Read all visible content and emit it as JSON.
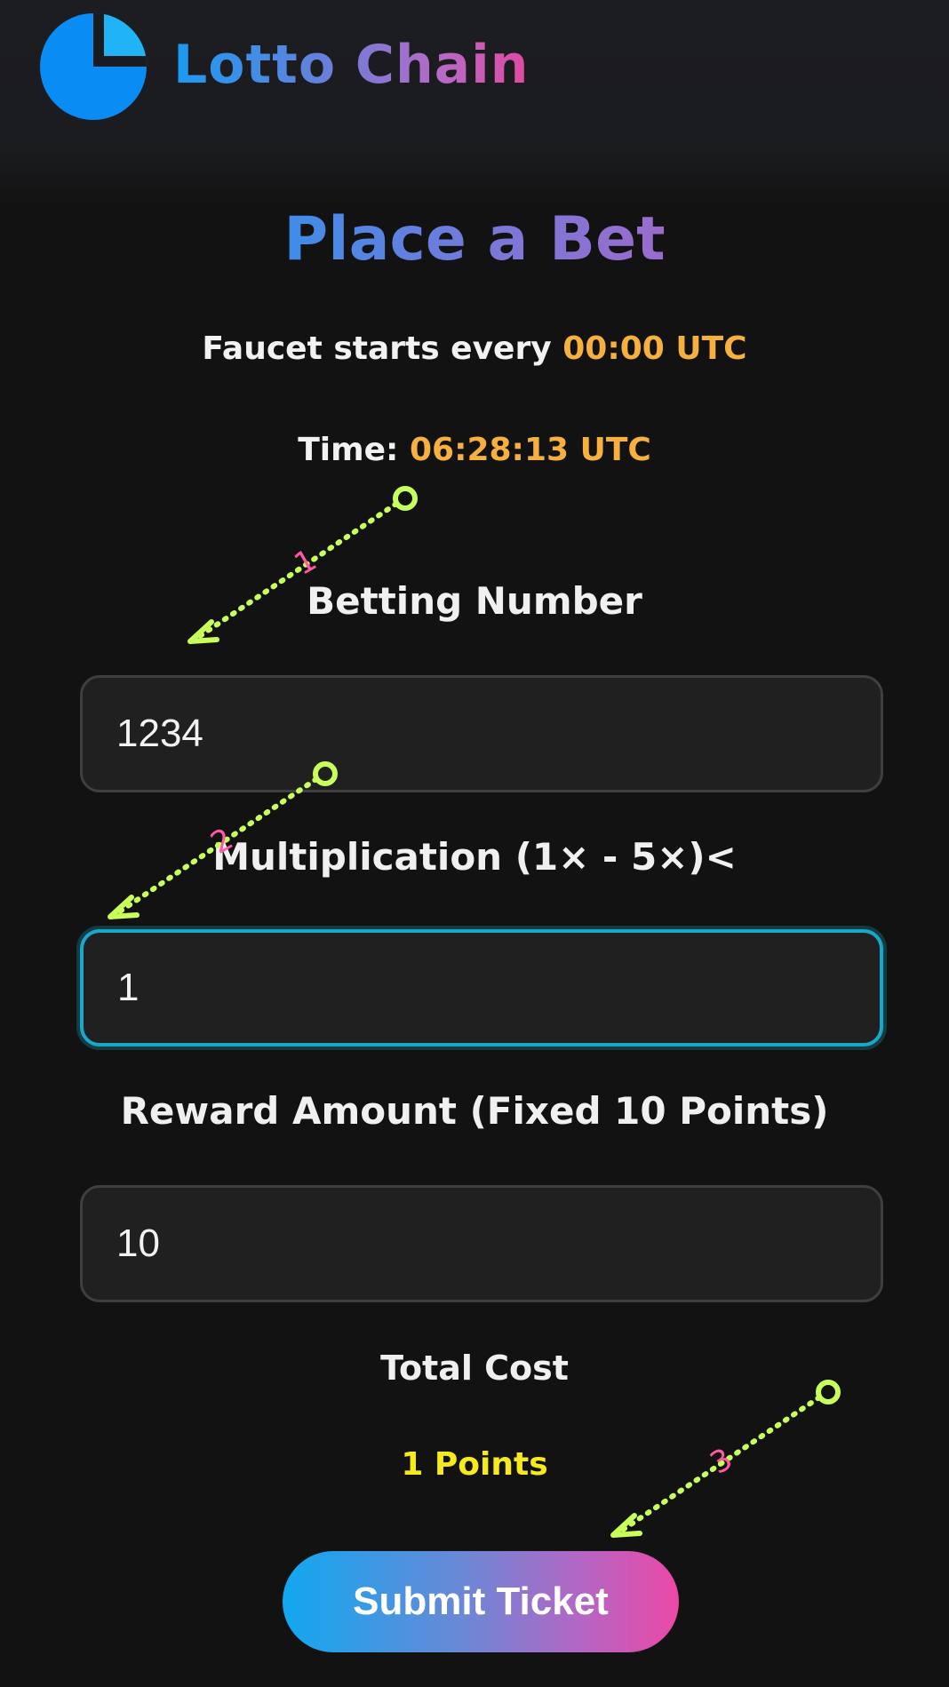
{
  "header": {
    "brand_name": "Lotto Chain",
    "logo_icon": "pie-chart-logo-icon"
  },
  "main": {
    "title": "Place a Bet",
    "faucet_prefix": "Faucet starts every ",
    "faucet_time": "00:00 UTC",
    "time_prefix": "Time: ",
    "time_value": "06:28:13 UTC"
  },
  "form": {
    "betting_label": "Betting Number",
    "betting_value": "1234",
    "multiplication_label": "Multiplication (1× - 5×)<",
    "multiplication_value": "1",
    "reward_label": "Reward Amount (Fixed 10 Points)",
    "reward_value": "10",
    "total_label": "Total Cost",
    "total_value": "1 Points",
    "submit_label": "Submit Ticket"
  },
  "annotations": [
    {
      "number": "1"
    },
    {
      "number": "2"
    },
    {
      "number": "3"
    }
  ],
  "colors": {
    "background": "#121212",
    "highlight_orange": "#f5b040",
    "total_yellow": "#f4ea1e",
    "focus_teal": "#1aa8c8",
    "arrow_green": "#c8ff5a",
    "annotation_pink": "#ff5aa5"
  }
}
